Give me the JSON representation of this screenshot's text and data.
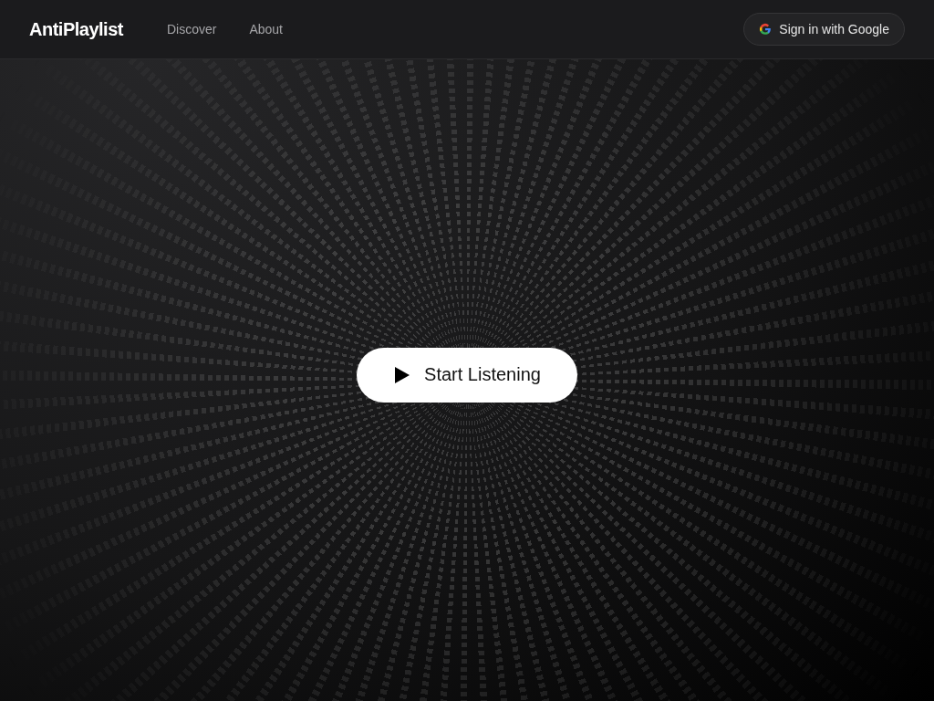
{
  "header": {
    "brand": "AntiPlaylist",
    "nav": [
      {
        "label": "Discover"
      },
      {
        "label": "About"
      }
    ],
    "sign_in": {
      "label": "Sign in with Google"
    }
  },
  "hero": {
    "button": {
      "label": "Start Listening"
    }
  }
}
